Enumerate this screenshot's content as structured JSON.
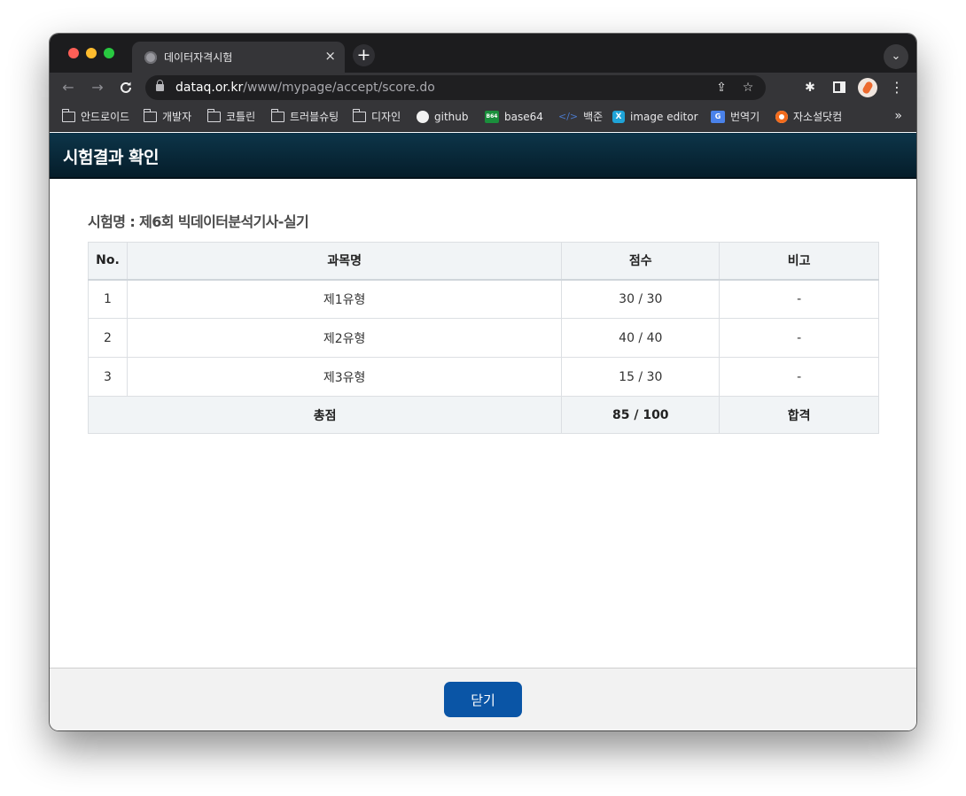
{
  "browser": {
    "tab_title": "데이터자격시험",
    "tab_close": "×",
    "new_tab": "+",
    "tab_search": "⌄",
    "nav_back": "←",
    "nav_forward": "→",
    "reload": "C",
    "url_host": "dataq.or.kr",
    "url_path": "/www/mypage/accept/score.do",
    "share": "⇪",
    "bookmark_star": "☆",
    "extensions": "✱",
    "menu": "⋮",
    "bookmarks_more": "»",
    "bookmarks": [
      {
        "label": "안드로이드",
        "icon": "folder-icon"
      },
      {
        "label": "개발자",
        "icon": "folder-icon"
      },
      {
        "label": "코틀린",
        "icon": "folder-icon"
      },
      {
        "label": "트러블슈팅",
        "icon": "folder-icon"
      },
      {
        "label": "디자인",
        "icon": "folder-icon"
      },
      {
        "label": "github",
        "icon": "github-icon"
      },
      {
        "label": "base64",
        "icon": "base64-icon",
        "icon_text": "B64"
      },
      {
        "label": "백준",
        "icon": "code-icon",
        "icon_text": "</>"
      },
      {
        "label": "image editor",
        "icon": "image-editor-icon",
        "icon_text": "X"
      },
      {
        "label": "번역기",
        "icon": "google-translate-icon",
        "icon_text": "G"
      },
      {
        "label": "자소설닷컴",
        "icon": "jasoseol-icon"
      }
    ]
  },
  "page": {
    "title": "시험결과 확인",
    "exam_name": "시험명 : 제6회 빅데이터분석기사-실기",
    "table": {
      "headers": [
        "No.",
        "과목명",
        "점수",
        "비고"
      ],
      "rows": [
        {
          "no": "1",
          "subject": "제1유형",
          "score": "30 / 30",
          "note": "-"
        },
        {
          "no": "2",
          "subject": "제2유형",
          "score": "40 / 40",
          "note": "-"
        },
        {
          "no": "3",
          "subject": "제3유형",
          "score": "15 / 30",
          "note": "-"
        }
      ],
      "total": {
        "label": "총점",
        "score": "85 / 100",
        "result": "합격"
      }
    },
    "close_button": "닫기"
  },
  "colors": {
    "header_bg": "#0d3549",
    "close_button_bg": "#0a55a6",
    "table_header_bg": "#f1f4f6"
  }
}
